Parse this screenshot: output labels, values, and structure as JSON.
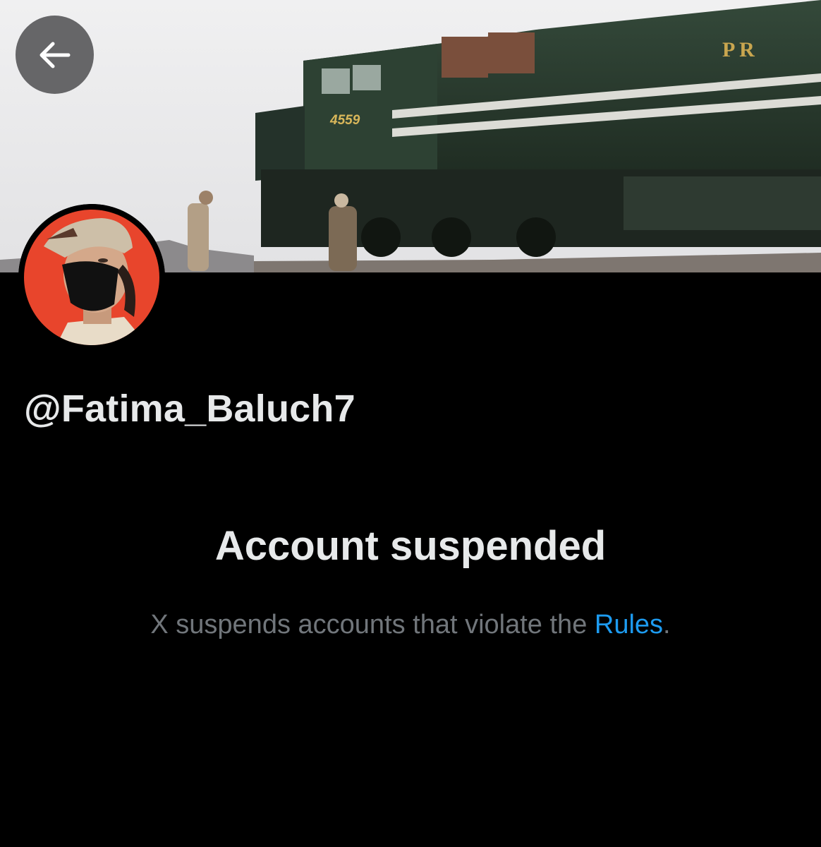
{
  "header": {
    "back_icon": "arrow-left-icon",
    "banner_locomotive_number": "4559",
    "banner_locomotive_letters": "P R"
  },
  "profile": {
    "handle": "@Fatima_Baluch7"
  },
  "notice": {
    "title": "Account suspended",
    "description_prefix": "X suspends accounts that violate the ",
    "rules_link": "Rules",
    "description_suffix": "."
  },
  "colors": {
    "background": "#000000",
    "text_primary": "#e7e9ea",
    "text_secondary": "#71767b",
    "link": "#1d9bf0",
    "avatar_background": "#e8452c",
    "locomotive_green": "#2a3b2e"
  }
}
